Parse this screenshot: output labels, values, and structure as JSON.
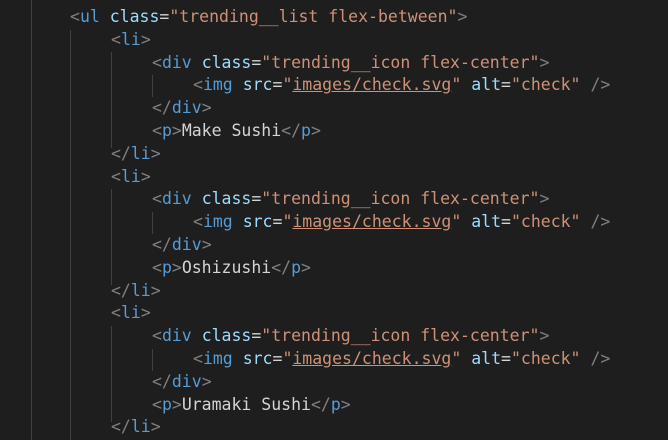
{
  "ul": {
    "tag": "ul",
    "attr": "class",
    "value": "trending__list flex-between"
  },
  "items": [
    {
      "text": "Make Sushi"
    },
    {
      "text": "Oshizushi"
    },
    {
      "text": "Uramaki Sushi"
    }
  ],
  "li": "li",
  "div": {
    "tag": "div",
    "attr": "class",
    "value": "trending__icon flex-center"
  },
  "img": {
    "tag": "img",
    "src_attr": "src",
    "src": "images/check.svg",
    "alt_attr": "alt",
    "alt": "check"
  },
  "p": "p"
}
